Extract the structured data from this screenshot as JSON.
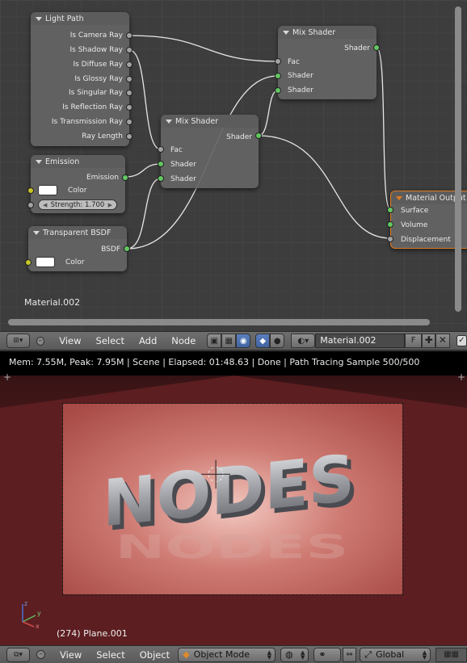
{
  "node_editor": {
    "nodes": {
      "light_path": {
        "title": "Light Path",
        "outputs": [
          "Is Camera Ray",
          "Is Shadow Ray",
          "Is Diffuse Ray",
          "Is Glossy Ray",
          "Is Singular Ray",
          "Is Reflection Ray",
          "Is Transmission Ray",
          "Ray Length"
        ]
      },
      "emission": {
        "title": "Emission",
        "output": "Emission",
        "color_label": "Color",
        "strength": "Strength: 1.700"
      },
      "transparent_bsdf": {
        "title": "Transparent BSDF",
        "output": "BSDF",
        "color_label": "Color"
      },
      "mix_shader_1": {
        "title": "Mix Shader",
        "output": "Shader",
        "inputs": [
          "Fac",
          "Shader",
          "Shader"
        ]
      },
      "mix_shader_2": {
        "title": "Mix Shader",
        "output": "Shader",
        "inputs": [
          "Fac",
          "Shader",
          "Shader"
        ]
      },
      "material_output": {
        "title": "Material Output",
        "inputs": [
          "Surface",
          "Volume",
          "Displacement"
        ]
      }
    },
    "material_name": "Material.002",
    "socket_colors": {
      "float": "#a3a3a3",
      "shader": "#63c763",
      "color": "#c7c729"
    }
  },
  "node_header": {
    "menus": [
      "View",
      "Select",
      "Add",
      "Node"
    ],
    "material_field": "Material.002",
    "f_label": "F"
  },
  "viewport": {
    "render_info": "Mem: 7.55M, Peak: 7.95M | Scene | Elapsed: 01:48.63 | Done | Path Tracing Sample 500/500",
    "render_text": "NODES",
    "object_label": "(274) Plane.001",
    "axis_labels": {
      "x": "x",
      "y": "y",
      "z": "z"
    },
    "wall_color": "#6e2426",
    "floor_color": "#b85a55"
  },
  "view_header": {
    "menus": [
      "View",
      "Select",
      "Object"
    ],
    "mode": "Object Mode",
    "orientation": "Global"
  }
}
